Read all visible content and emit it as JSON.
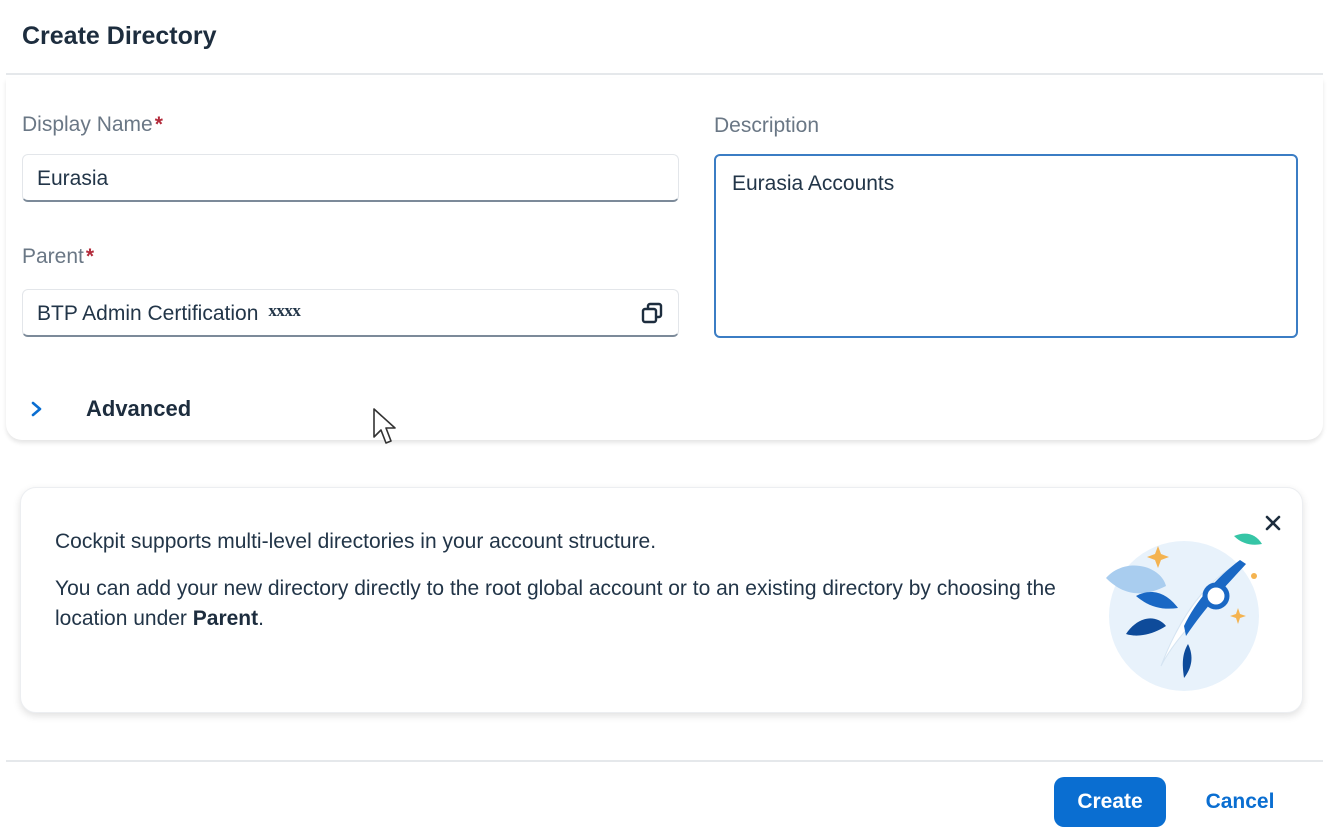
{
  "dialog": {
    "title": "Create Directory"
  },
  "form": {
    "display_name": {
      "label": "Display Name",
      "required_mark": "*",
      "value": "Eurasia"
    },
    "parent": {
      "label": "Parent",
      "required_mark": "*",
      "value": "BTP Admin Certification",
      "masked_suffix": "xxxx",
      "icon": "value-help-icon"
    },
    "description": {
      "label": "Description",
      "value": "Eurasia Accounts"
    },
    "advanced": {
      "label": "Advanced",
      "icon": "chevron-right-icon"
    }
  },
  "info": {
    "line1": "Cockpit supports multi-level directories in your account structure.",
    "line2_prefix": "You can add your new directory directly to the root global account or to an existing directory by choosing the location under ",
    "line2_bold": "Parent",
    "line2_suffix": ".",
    "close_icon": "close-icon",
    "illustration": "rocket-illustration"
  },
  "footer": {
    "create_label": "Create",
    "cancel_label": "Cancel"
  },
  "colors": {
    "accent": "#0a6ed1",
    "required": "#b22a3a",
    "focus_border": "#3b7dc4"
  }
}
